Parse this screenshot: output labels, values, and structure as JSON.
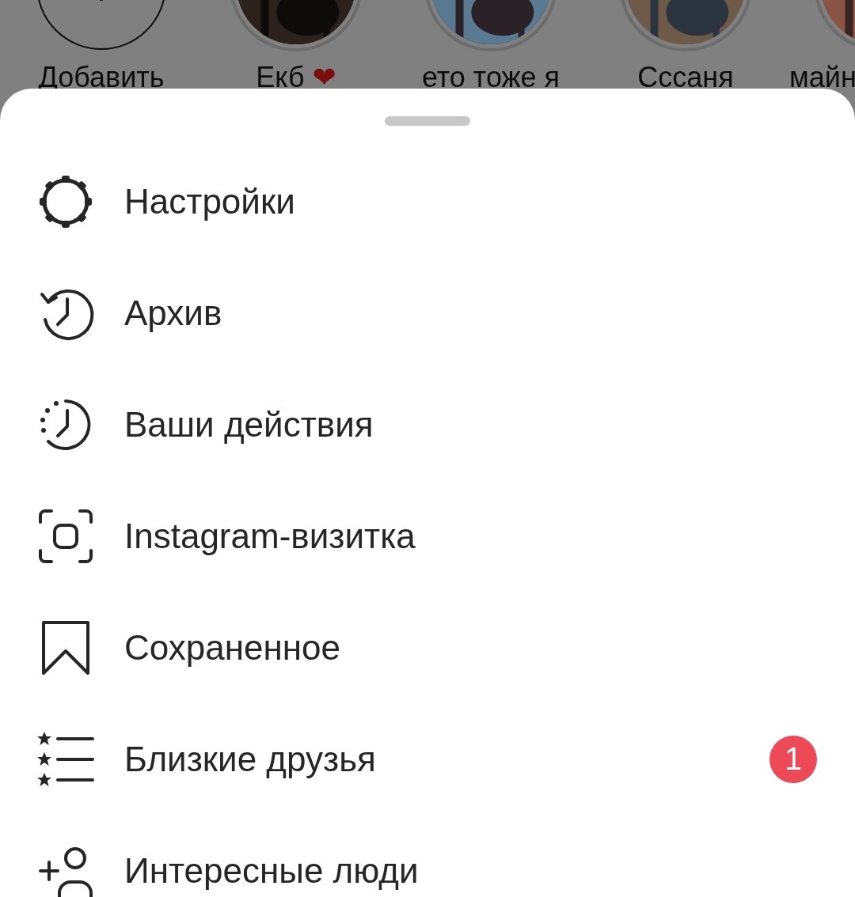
{
  "stories": [
    {
      "kind": "add",
      "label": "Добавить"
    },
    {
      "kind": "story",
      "label": "Екб",
      "emoji": "❤"
    },
    {
      "kind": "story",
      "label": "ето тоже я"
    },
    {
      "kind": "story",
      "label": "Сссаня"
    },
    {
      "kind": "story",
      "label": "майн"
    }
  ],
  "menu": [
    {
      "kind": "settings",
      "label": "Настройки"
    },
    {
      "kind": "archive",
      "label": "Архив"
    },
    {
      "kind": "activity",
      "label": "Ваши действия"
    },
    {
      "kind": "nametag",
      "label": "Instagram-визитка"
    },
    {
      "kind": "saved",
      "label": "Сохраненное"
    },
    {
      "kind": "close_friends",
      "label": "Близкие друзья",
      "badge": "1"
    },
    {
      "kind": "discover",
      "label": "Интересные люди"
    }
  ]
}
